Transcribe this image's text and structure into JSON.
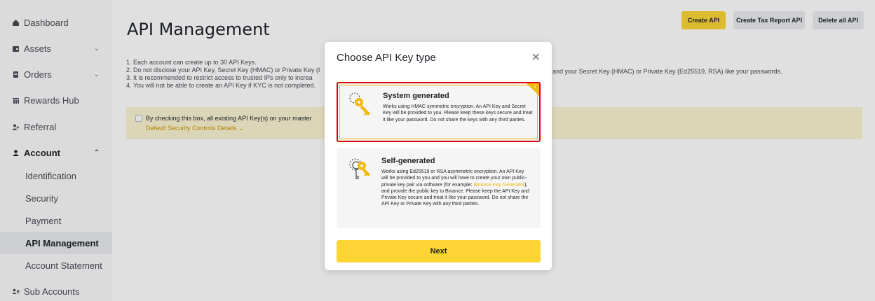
{
  "sidebar": {
    "items": [
      {
        "label": "Dashboard",
        "icon": "home-icon"
      },
      {
        "label": "Assets",
        "icon": "wallet-icon"
      },
      {
        "label": "Orders",
        "icon": "orders-icon"
      },
      {
        "label": "Rewards Hub",
        "icon": "rewards-icon"
      },
      {
        "label": "Referral",
        "icon": "referral-icon"
      },
      {
        "label": "Account",
        "icon": "user-icon"
      },
      {
        "label": "Sub Accounts",
        "icon": "sub-accounts-icon"
      }
    ],
    "account_sub": [
      "Identification",
      "Security",
      "Payment",
      "API Management",
      "Account Statement"
    ]
  },
  "main": {
    "title": "API Management",
    "buttons": {
      "create": "Create API",
      "tax": "Create Tax Report API",
      "delete": "Delete all API"
    },
    "notes": [
      "1. Each account can create up to 30 API Keys.",
      "2. Do not disclose your API Key, Secret Key (HMAC) or Private Key (I",
      "3. It is recommended to restrict access to trusted IPs only to increa",
      "4. You will not be able to create an API Key if KYC is not completed."
    ],
    "notes_right": "and your Secret Key (HMAC) or Private Key (Ed25519, RSA) like your passwords.",
    "warning": {
      "text": "By checking this box, all existing API Key(s) on your master",
      "link": "Default Security Controls Details ⌄"
    }
  },
  "modal": {
    "title": "Choose API Key type",
    "close": "✕",
    "option1": {
      "title": "System generated",
      "desc": "Works using HMAC symmetric encryption. An API Key and Secret Key will be provided to you. Please keep these keys secure and treat it like your password. Do not share the keys with any third parties."
    },
    "option2": {
      "title": "Self-generated",
      "desc_a": "Works using Ed25519 or RSA asymmetric encryption. An API Key will be provided to you and you will have to create your own public-private key pair via software (for example: ",
      "link": "Binance Key Generator",
      "desc_b": "), and provide the public key to Binance. Please keep the API Key and Private Key secure and treat it like your password. Do not share the API Key or Private Key with any third parties."
    },
    "next": "Next"
  },
  "colors": {
    "accent": "#fcd535",
    "highlight_border": "#d9001b",
    "link": "#f0b90b"
  }
}
